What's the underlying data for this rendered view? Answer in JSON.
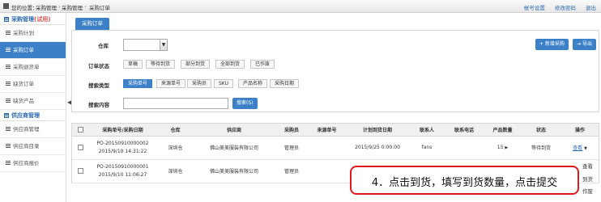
{
  "topbar": {
    "breadcrumb_prefix": "您的位置：",
    "crumbs": [
      "采购管理",
      "采购管理",
      "采购订单"
    ],
    "links": [
      "帐号设置",
      "修改密码",
      "退出"
    ]
  },
  "sidebar": {
    "section1_title": "采购管理",
    "section1_trial": "(试用)",
    "items1": [
      "采购计划",
      "采购订单",
      "采购退货单",
      "缺货订单",
      "缺货产品"
    ],
    "section2_title": "供应商管理",
    "items2": [
      "供应商管理",
      "供应商目录",
      "供应商报价"
    ]
  },
  "main": {
    "tab_label": "采购订单",
    "warehouse_label": "仓库",
    "status_label": "订单状态",
    "status_options": [
      "草稿",
      "等待到货",
      "部分到货",
      "全部到货",
      "已作废"
    ],
    "search_type_label": "搜索类型",
    "search_type_options": [
      "采购单号",
      "来源单号",
      "采购员",
      "SKU",
      "产品名称",
      "采购日期"
    ],
    "search_content_label": "搜索内容",
    "search_button": "搜索(S)",
    "add_button": "+ 新增采购",
    "export_button": "导出"
  },
  "table": {
    "headers": [
      "采购单号/采购日期",
      "仓库",
      "供应商",
      "采购员",
      "来源单号",
      "计划到货日期",
      "联系人",
      "联系电话",
      "产品数量",
      "状态",
      "操作"
    ],
    "rows": [
      {
        "po": "PO-20150910000002",
        "date": "2015/9/10 14:31:22",
        "warehouse": "深圳仓",
        "supplier": "佛山美美服装有限公司",
        "buyer": "管理员",
        "source": "",
        "eta": "2015/9/25 0:00:00",
        "contact": "fans",
        "phone": "",
        "qty": "15",
        "status": "等待到货",
        "op": "查看"
      },
      {
        "po": "PO-20150910000001",
        "date": "2015/9/10 11:06:27",
        "warehouse": "深圳仓",
        "supplier": "佛山美美服装有限公司",
        "buyer": "管理员",
        "source": "",
        "eta": "",
        "contact": "",
        "phone": "",
        "qty": "",
        "status": "",
        "op": ""
      }
    ]
  },
  "side_ops": [
    "查看",
    "到货",
    "作废"
  ],
  "callout": {
    "text": "4．点击到货，填写到货数量，点击提交"
  },
  "colors": {
    "accent": "#3c80c8",
    "callout_border": "#e0191c",
    "trial": "#d9534f"
  }
}
